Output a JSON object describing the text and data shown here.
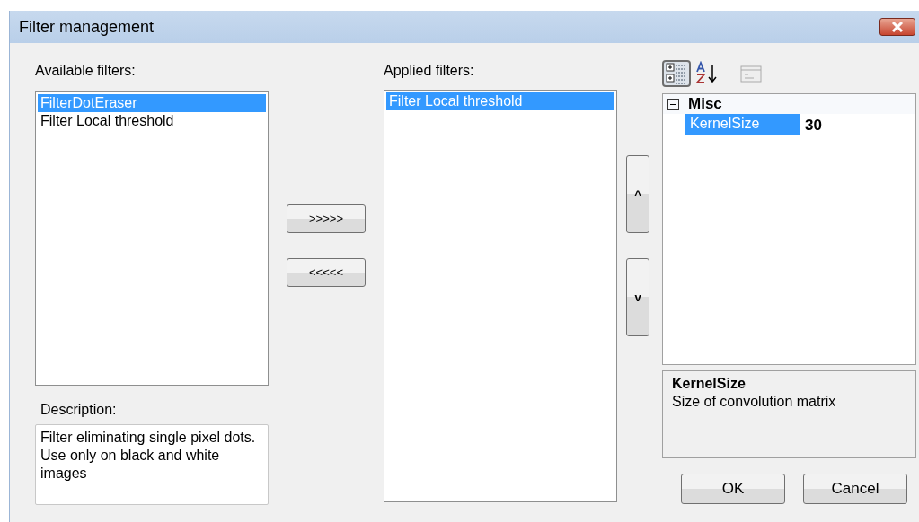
{
  "window": {
    "title": "Filter management"
  },
  "available": {
    "label": "Available filters:",
    "items": [
      {
        "text": "FilterDotEraser",
        "selected": true
      },
      {
        "text": "Filter Local threshold",
        "selected": false
      }
    ]
  },
  "description": {
    "label": "Description:",
    "text": "Filter eliminating single pixel dots. Use only on black and white images"
  },
  "transfer_buttons": [
    ">>>>>",
    "<<<<<"
  ],
  "applied": {
    "label": "Applied filters:",
    "items": [
      {
        "text": "Filter Local threshold",
        "selected": true
      }
    ]
  },
  "order_buttons": [
    "^",
    "v"
  ],
  "property_toolbar": [
    {
      "kind": "categorized",
      "selected": true
    },
    {
      "kind": "alphabetical",
      "selected": false
    },
    {
      "kind": "pages",
      "selected": false
    }
  ],
  "property_grid": {
    "categories": [
      {
        "name": "Misc",
        "expanded": true,
        "properties": [
          {
            "name": "KernelSize",
            "value": "30",
            "selected": true
          }
        ]
      }
    ]
  },
  "help": {
    "title": "KernelSize",
    "text": "Size of convolution matrix"
  },
  "dialog_buttons": [
    "OK",
    "Cancel"
  ]
}
